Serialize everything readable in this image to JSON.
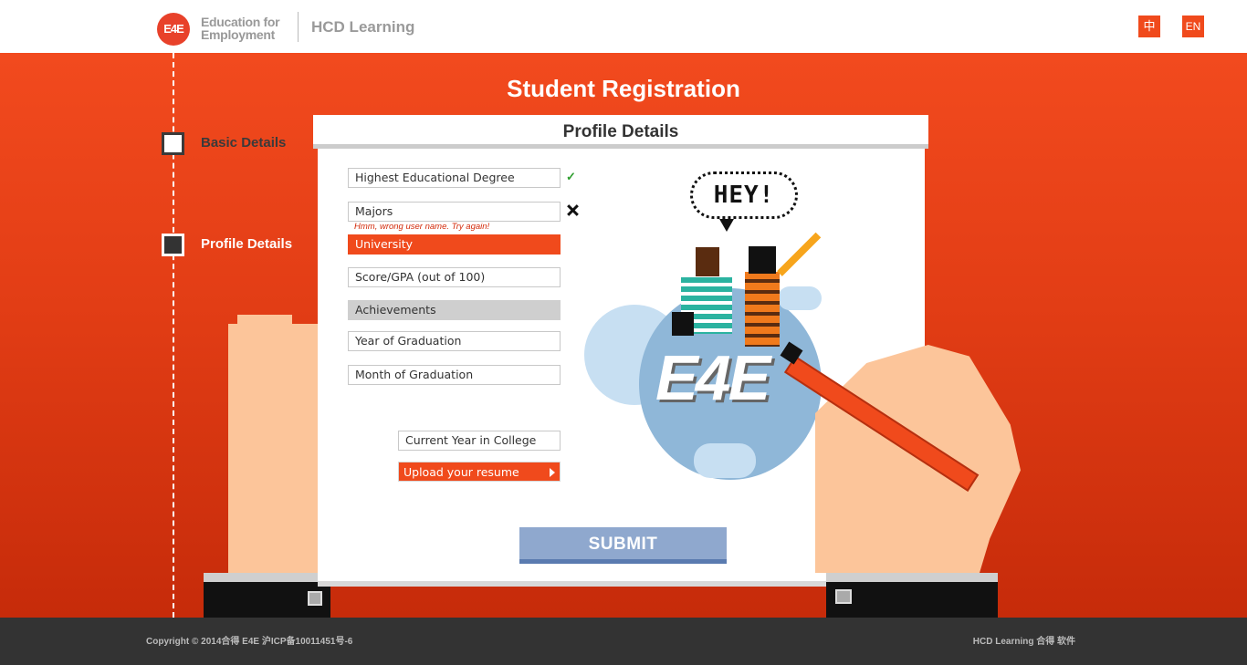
{
  "header": {
    "logo_badge": "E4E",
    "logo_line1": "Education for",
    "logo_line2": "Employment",
    "app_name": "HCD Learning",
    "lang_zh": "中",
    "lang_en": "EN"
  },
  "page": {
    "title": "Student Registration"
  },
  "steps": [
    {
      "label": "Basic Details"
    },
    {
      "label": "Profile Details"
    }
  ],
  "form": {
    "heading": "Profile Details",
    "degree": "Highest Educational Degree",
    "majors": "Majors",
    "majors_error": "Hmm, wrong user name. Try again!",
    "university": "University",
    "score": "Score/GPA (out of 100)",
    "achievements": "Achievements",
    "grad_year": "Year of Graduation",
    "grad_month": "Month of Graduation",
    "current_year": "Current Year in College",
    "upload": "Upload your resume",
    "submit": "SUBMIT"
  },
  "illustration": {
    "bubble": "HEY!",
    "logo": "E4E"
  },
  "footer": {
    "copyright": "Copyright © 2014合得 E4E 沪ICP备10011451号-6",
    "right": "HCD Learning 合得 软件"
  },
  "colors": {
    "accent": "#f04a1c",
    "submit": "#8fa8ce",
    "footer": "#333333",
    "valid": "#2e9e2e"
  },
  "icons": [
    "check-icon",
    "x-icon",
    "arrow-right-icon",
    "step-checkbox-icon"
  ]
}
